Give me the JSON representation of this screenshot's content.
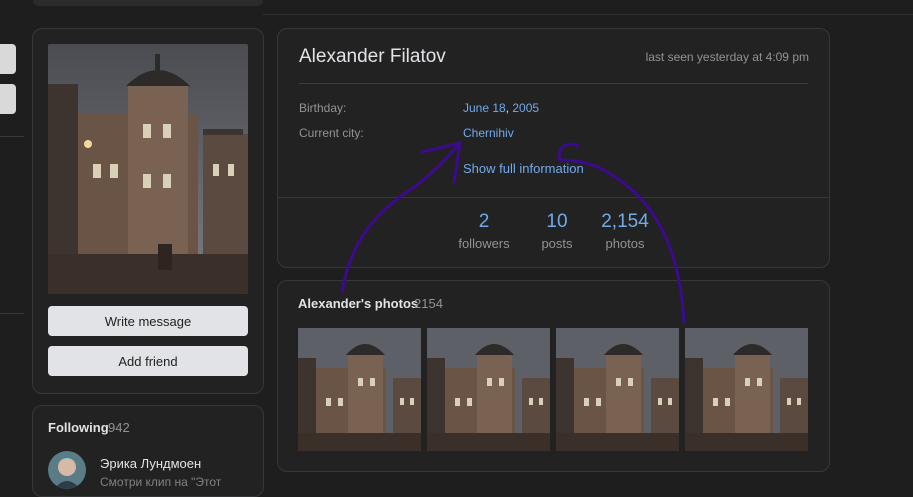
{
  "profile": {
    "name": "Alexander Filatov",
    "last_seen": "last seen yesterday at 4:09 pm",
    "birthday_label": "Birthday:",
    "birthday_day": "June 18",
    "birthday_sep": ", ",
    "birthday_year": "2005",
    "city_label": "Current city:",
    "city_value": "Chernihiv",
    "show_full": "Show full information"
  },
  "stats": [
    {
      "value": "2",
      "label": "followers"
    },
    {
      "value": "10",
      "label": "posts"
    },
    {
      "value": "2,154",
      "label": "photos"
    }
  ],
  "actions": {
    "write_message": "Write message",
    "add_friend": "Add friend"
  },
  "following": {
    "title": "Following",
    "count": "942",
    "items": [
      {
        "name": "Эрика Лундмоен",
        "subtitle": "Смотри клип на \"Этот"
      }
    ]
  },
  "photos": {
    "title": "Alexander's photos",
    "count": "2154"
  },
  "colors": {
    "background": "#1e1e1e",
    "card": "#222222",
    "link": "#71aaeb",
    "annotation": "#3c0a8c"
  }
}
